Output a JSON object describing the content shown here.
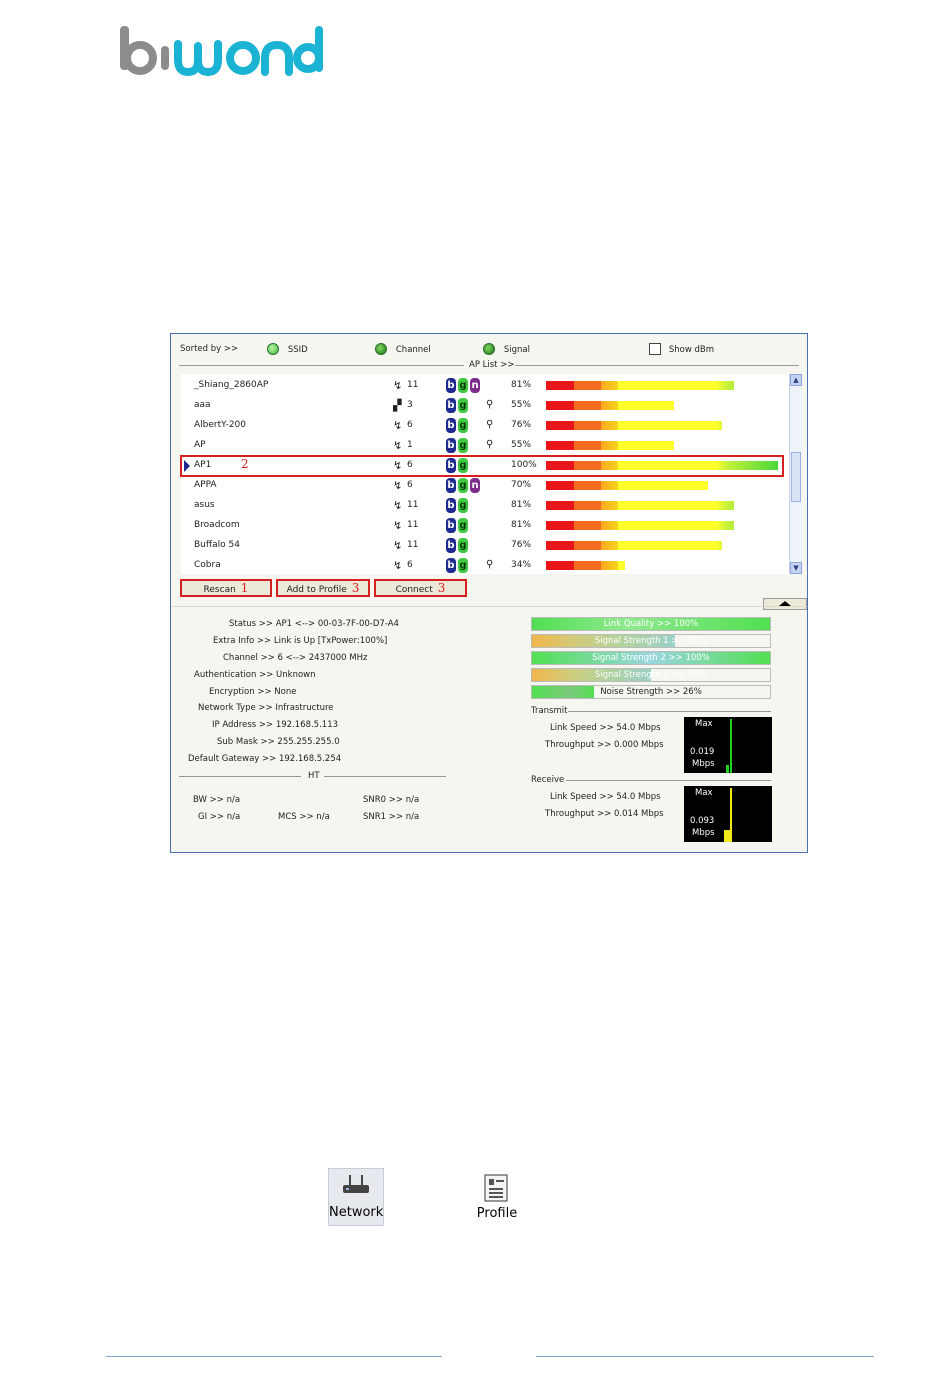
{
  "brand": {
    "logo_text": "biwond"
  },
  "toolbar": {
    "sorted_by": "Sorted by >>",
    "sort_ssid": "SSID",
    "sort_channel": "Channel",
    "sort_signal": "Signal",
    "show_dbm": "Show dBm",
    "ap_list": "AP List >>"
  },
  "ap_rows": [
    {
      "ssid": "_Shiang_2860AP",
      "icon": "antenna-icon",
      "channel": "11",
      "b": true,
      "g": true,
      "n": true,
      "lock": false,
      "signal": "81%",
      "value": 81
    },
    {
      "ssid": "aaa",
      "icon": "adhoc-icon",
      "channel": "3",
      "b": true,
      "g": true,
      "n": false,
      "lock": true,
      "signal": "55%",
      "value": 55
    },
    {
      "ssid": "AlbertY-200",
      "icon": "antenna-icon",
      "channel": "6",
      "b": true,
      "g": true,
      "n": false,
      "lock": true,
      "signal": "76%",
      "value": 76
    },
    {
      "ssid": "AP",
      "icon": "antenna-icon",
      "channel": "1",
      "b": true,
      "g": true,
      "n": false,
      "lock": true,
      "signal": "55%",
      "value": 55
    },
    {
      "ssid": "AP1",
      "icon": "antenna-icon",
      "channel": "6",
      "b": true,
      "g": true,
      "n": false,
      "lock": false,
      "signal": "100%",
      "value": 100,
      "selected": true,
      "annotation": "2"
    },
    {
      "ssid": "APPA",
      "icon": "antenna-icon",
      "channel": "6",
      "b": true,
      "g": true,
      "n": true,
      "lock": false,
      "signal": "70%",
      "value": 70
    },
    {
      "ssid": "asus",
      "icon": "antenna-icon",
      "channel": "11",
      "b": true,
      "g": true,
      "n": false,
      "lock": false,
      "signal": "81%",
      "value": 81
    },
    {
      "ssid": "Broadcom",
      "icon": "antenna-icon",
      "channel": "11",
      "b": true,
      "g": true,
      "n": false,
      "lock": false,
      "signal": "81%",
      "value": 81
    },
    {
      "ssid": "Buffalo 54",
      "icon": "antenna-icon",
      "channel": "11",
      "b": true,
      "g": true,
      "n": false,
      "lock": false,
      "signal": "76%",
      "value": 76
    },
    {
      "ssid": "Cobra",
      "icon": "antenna-icon",
      "channel": "6",
      "b": true,
      "g": true,
      "n": false,
      "lock": true,
      "signal": "34%",
      "value": 34
    }
  ],
  "buttons": {
    "rescan": "Rescan",
    "rescan_num": "1",
    "add_profile": "Add to Profile",
    "add_profile_num": "3",
    "connect": "Connect",
    "connect_num": "3"
  },
  "info": {
    "status": "Status >> AP1 <--> 00-03-7F-00-D7-A4",
    "extra": "Extra Info >> Link is Up [TxPower:100%]",
    "channel": "Channel >> 6 <--> 2437000 MHz",
    "auth": "Authentication >> Unknown",
    "enc": "Encryption >> None",
    "nettype": "Network Type >> Infrastructure",
    "ip": "IP Address >> 192.168.5.113",
    "mask": "Sub Mask >> 255.255.255.0",
    "gateway": "Default Gateway >> 192.168.5.254",
    "ht": "HT",
    "bw": "BW >> n/a",
    "gi": "GI >> n/a",
    "mcs": "MCS >> n/a",
    "snr0": "SNR0 >> n/a",
    "snr1": "SNR1 >> n/a"
  },
  "quality": {
    "link_quality": "Link Quality >> 100%",
    "sig1": "Signal Strength 1 >> 60%",
    "sig2": "Signal Strength 2 >> 100%",
    "sig3": "Signal Strength 3 >> 50%",
    "noise": "Noise Strength >> 26%",
    "levels": {
      "link_quality": 100,
      "sig1": 60,
      "sig2": 100,
      "sig3": 50,
      "noise": 26
    }
  },
  "transmit": {
    "title": "Transmit",
    "link_speed": "Link Speed >> 54.0 Mbps",
    "throughput": "Throughput >> 0.000 Mbps",
    "graph_max": "Max",
    "graph_value": "0.019",
    "graph_unit": "Mbps"
  },
  "receive": {
    "title": "Receive",
    "link_speed": "Link Speed >> 54.0 Mbps",
    "throughput": "Throughput >> 0.014 Mbps",
    "graph_max": "Max",
    "graph_value": "0.093",
    "graph_unit": "Mbps"
  },
  "bottom_icons": {
    "network": "Network",
    "profile": "Profile"
  }
}
